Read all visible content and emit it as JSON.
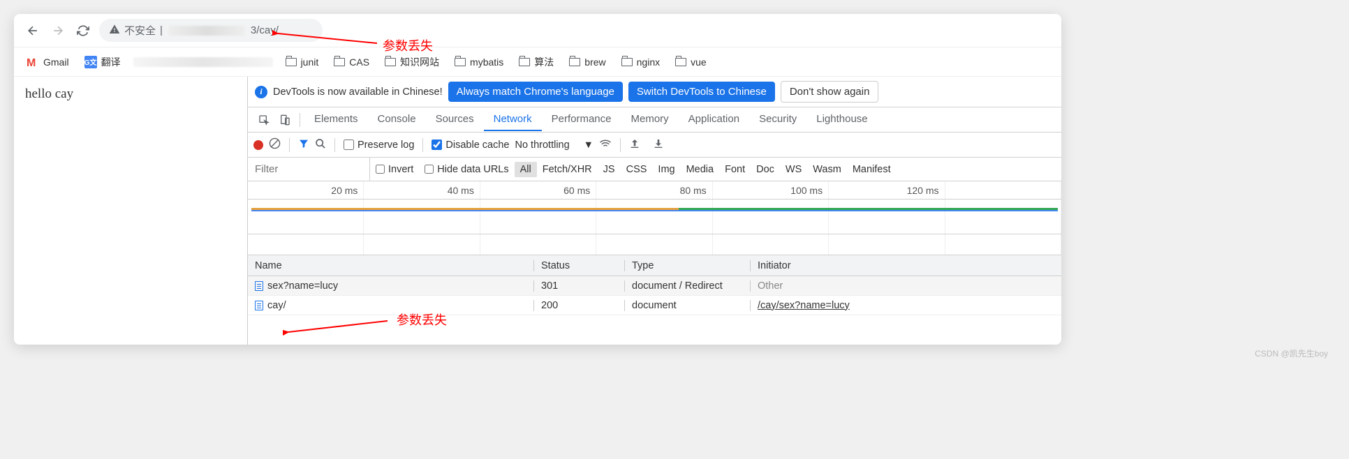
{
  "url": {
    "insecure_label": "不安全",
    "visible_path": "3/cay/"
  },
  "bookmarks": {
    "gmail": "Gmail",
    "translate": "翻译",
    "folders": [
      "junit",
      "CAS",
      "知识网站",
      "mybatis",
      "算法",
      "brew",
      "nginx",
      "vue"
    ]
  },
  "page_content": "hello cay",
  "devtools": {
    "info_bar": {
      "text": "DevTools is now available in Chinese!",
      "btn_match": "Always match Chrome's language",
      "btn_switch": "Switch DevTools to Chinese",
      "btn_dismiss": "Don't show again"
    },
    "tabs": [
      "Elements",
      "Console",
      "Sources",
      "Network",
      "Performance",
      "Memory",
      "Application",
      "Security",
      "Lighthouse"
    ],
    "active_tab": "Network",
    "controls": {
      "preserve_log": "Preserve log",
      "disable_cache": "Disable cache",
      "disable_cache_checked": true,
      "throttling": "No throttling"
    },
    "filter": {
      "placeholder": "Filter",
      "invert": "Invert",
      "hide_data": "Hide data URLs",
      "pills": [
        "All",
        "Fetch/XHR",
        "JS",
        "CSS",
        "Img",
        "Media",
        "Font",
        "Doc",
        "WS",
        "Wasm",
        "Manifest"
      ],
      "active_pill": "All"
    },
    "timeline_ticks": [
      "20 ms",
      "40 ms",
      "60 ms",
      "80 ms",
      "100 ms",
      "120 ms"
    ],
    "table": {
      "headers": {
        "name": "Name",
        "status": "Status",
        "type": "Type",
        "initiator": "Initiator"
      },
      "rows": [
        {
          "name": "sex?name=lucy",
          "status": "301",
          "type": "document / Redirect",
          "initiator": "Other",
          "initiator_link": false
        },
        {
          "name": "cay/",
          "status": "200",
          "type": "document",
          "initiator": "/cay/sex?name=lucy",
          "initiator_link": true
        }
      ]
    }
  },
  "annotations": {
    "label1": "参数丢失",
    "label2": "参数丢失"
  },
  "watermark": "CSDN @凯先生boy"
}
